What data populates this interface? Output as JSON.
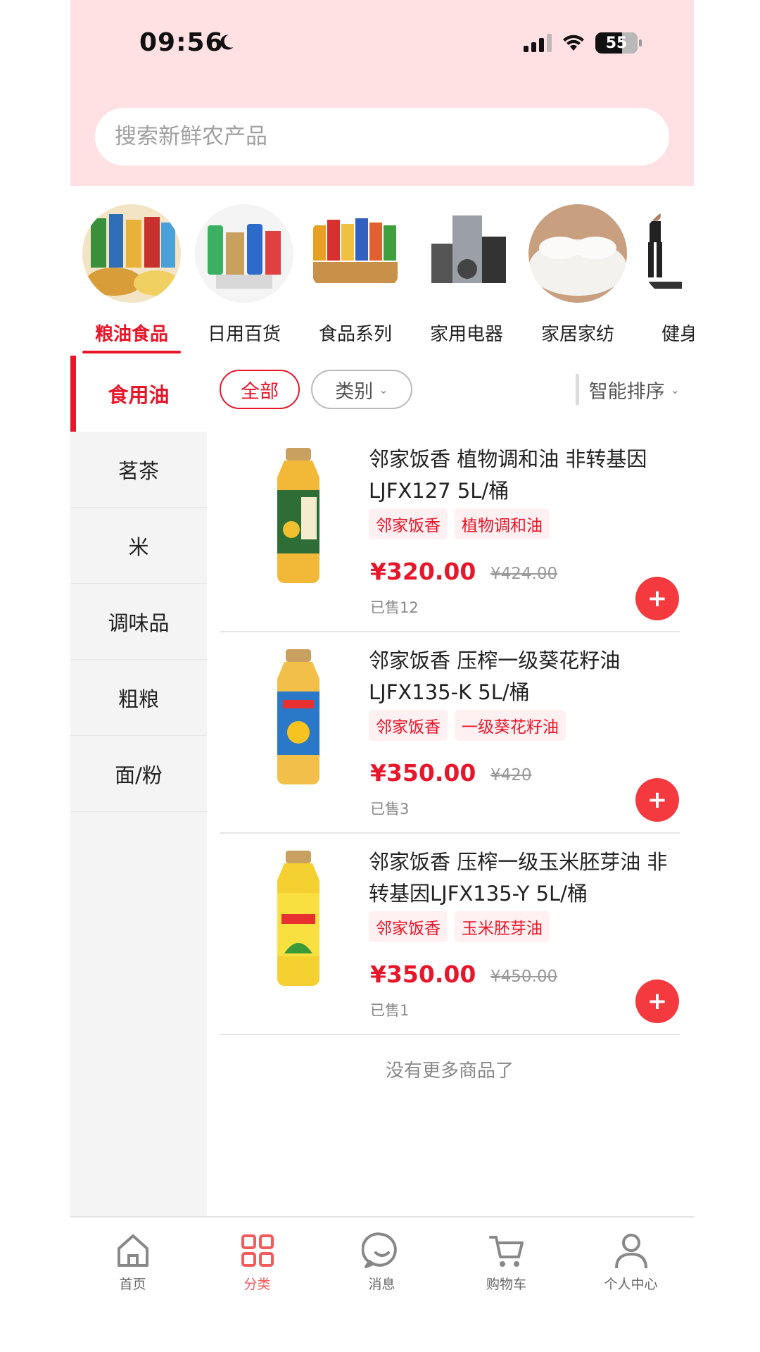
{
  "status_bar": {
    "time": "09:56",
    "battery": "55"
  },
  "search": {
    "placeholder": "搜索新鲜农产品"
  },
  "categories": [
    {
      "label": "粮油食品",
      "active": true
    },
    {
      "label": "日用百货",
      "active": false
    },
    {
      "label": "食品系列",
      "active": false
    },
    {
      "label": "家用电器",
      "active": false
    },
    {
      "label": "家居家纺",
      "active": false
    },
    {
      "label": "健身器",
      "active": false
    }
  ],
  "sidebar": {
    "items": [
      {
        "label": "食用油",
        "active": true
      },
      {
        "label": "茗茶"
      },
      {
        "label": "米"
      },
      {
        "label": "调味品"
      },
      {
        "label": "粗粮"
      },
      {
        "label": "面/粉"
      }
    ]
  },
  "filters": {
    "all": "全部",
    "type": "类别",
    "sort": "智能排序"
  },
  "products": [
    {
      "title": "邻家饭香 植物调和油 非转基因LJFX127 5L/桶",
      "tags": [
        "邻家饭香",
        "植物调和油"
      ],
      "price": "¥320.00",
      "old_price": "¥424.00",
      "sold": "已售12"
    },
    {
      "title": "邻家饭香 压榨一级葵花籽油LJFX135-K 5L/桶",
      "tags": [
        "邻家饭香",
        "一级葵花籽油"
      ],
      "price": "¥350.00",
      "old_price": "¥420",
      "sold": "已售3"
    },
    {
      "title": "邻家饭香 压榨一级玉米胚芽油 非转基因LJFX135-Y 5L/桶",
      "tags": [
        "邻家饭香",
        "玉米胚芽油"
      ],
      "price": "¥350.00",
      "old_price": "¥450.00",
      "sold": "已售1"
    }
  ],
  "no_more": "没有更多商品了",
  "bottom_nav": [
    {
      "label": "首页",
      "icon": "home-icon"
    },
    {
      "label": "分类",
      "icon": "grid-icon",
      "active": true
    },
    {
      "label": "消息",
      "icon": "message-icon"
    },
    {
      "label": "购物车",
      "icon": "cart-icon"
    },
    {
      "label": "个人中心",
      "icon": "user-icon"
    }
  ],
  "colors": {
    "accent": "#e8162a",
    "header_bg": "#ffe0e3",
    "add_button": "#f43a3e"
  }
}
